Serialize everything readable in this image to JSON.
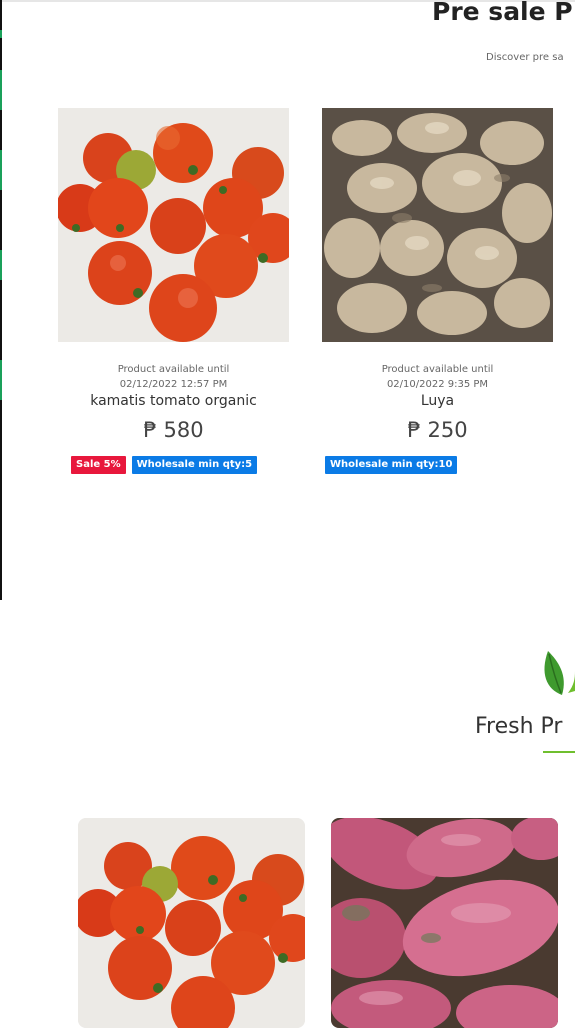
{
  "presale": {
    "title": "Pre sale P",
    "subtitle": "Discover pre sa",
    "products": [
      {
        "image": "tomatoes-photo",
        "available_label": "Product available until",
        "available_date": "02/12/2022 12:57 PM",
        "name": "kamatis tomato organic",
        "price": "₱ 580",
        "badges": [
          {
            "type": "sale",
            "label": "Sale 5%"
          },
          {
            "type": "wholesale",
            "label": "Wholesale min qty:5"
          }
        ]
      },
      {
        "image": "ginger-photo",
        "available_label": "Product available until",
        "available_date": "02/10/2022 9:35 PM",
        "name": "Luya",
        "price": "₱ 250",
        "badges": [
          {
            "type": "wholesale",
            "label": "Wholesale min qty:10"
          }
        ]
      }
    ]
  },
  "fresh": {
    "icon": "leaf-icon",
    "title": "Fresh Pr",
    "products": [
      {
        "image": "tomatoes-photo"
      },
      {
        "image": "sweet-potato-photo"
      }
    ]
  },
  "colors": {
    "sale_badge": "#e8173c",
    "wholesale_badge": "#0b7be6",
    "accent_green": "#6fbf2e"
  }
}
